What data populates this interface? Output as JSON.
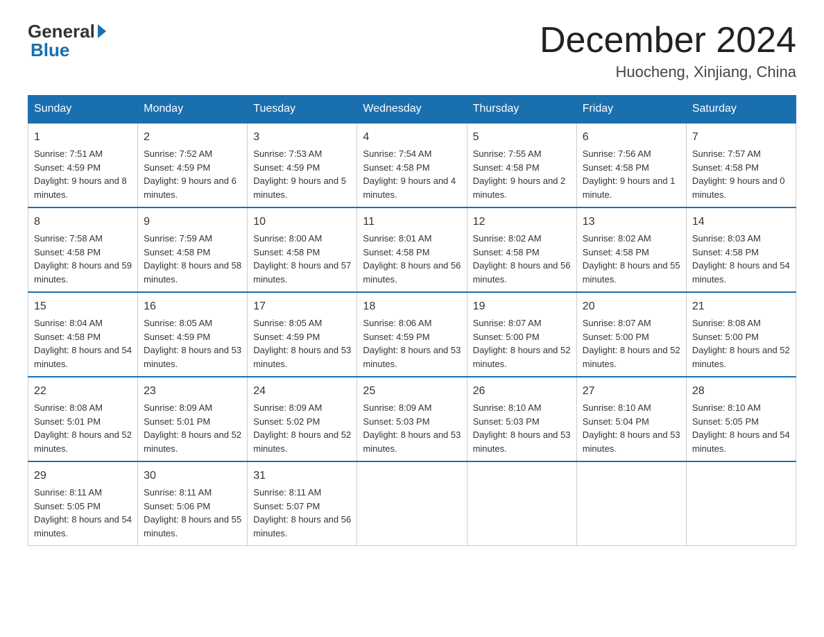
{
  "logo": {
    "general": "General",
    "blue": "Blue"
  },
  "title": "December 2024",
  "location": "Huocheng, Xinjiang, China",
  "headers": [
    "Sunday",
    "Monday",
    "Tuesday",
    "Wednesday",
    "Thursday",
    "Friday",
    "Saturday"
  ],
  "weeks": [
    [
      {
        "day": "1",
        "sunrise": "7:51 AM",
        "sunset": "4:59 PM",
        "daylight": "9 hours and 8 minutes."
      },
      {
        "day": "2",
        "sunrise": "7:52 AM",
        "sunset": "4:59 PM",
        "daylight": "9 hours and 6 minutes."
      },
      {
        "day": "3",
        "sunrise": "7:53 AM",
        "sunset": "4:59 PM",
        "daylight": "9 hours and 5 minutes."
      },
      {
        "day": "4",
        "sunrise": "7:54 AM",
        "sunset": "4:58 PM",
        "daylight": "9 hours and 4 minutes."
      },
      {
        "day": "5",
        "sunrise": "7:55 AM",
        "sunset": "4:58 PM",
        "daylight": "9 hours and 2 minutes."
      },
      {
        "day": "6",
        "sunrise": "7:56 AM",
        "sunset": "4:58 PM",
        "daylight": "9 hours and 1 minute."
      },
      {
        "day": "7",
        "sunrise": "7:57 AM",
        "sunset": "4:58 PM",
        "daylight": "9 hours and 0 minutes."
      }
    ],
    [
      {
        "day": "8",
        "sunrise": "7:58 AM",
        "sunset": "4:58 PM",
        "daylight": "8 hours and 59 minutes."
      },
      {
        "day": "9",
        "sunrise": "7:59 AM",
        "sunset": "4:58 PM",
        "daylight": "8 hours and 58 minutes."
      },
      {
        "day": "10",
        "sunrise": "8:00 AM",
        "sunset": "4:58 PM",
        "daylight": "8 hours and 57 minutes."
      },
      {
        "day": "11",
        "sunrise": "8:01 AM",
        "sunset": "4:58 PM",
        "daylight": "8 hours and 56 minutes."
      },
      {
        "day": "12",
        "sunrise": "8:02 AM",
        "sunset": "4:58 PM",
        "daylight": "8 hours and 56 minutes."
      },
      {
        "day": "13",
        "sunrise": "8:02 AM",
        "sunset": "4:58 PM",
        "daylight": "8 hours and 55 minutes."
      },
      {
        "day": "14",
        "sunrise": "8:03 AM",
        "sunset": "4:58 PM",
        "daylight": "8 hours and 54 minutes."
      }
    ],
    [
      {
        "day": "15",
        "sunrise": "8:04 AM",
        "sunset": "4:58 PM",
        "daylight": "8 hours and 54 minutes."
      },
      {
        "day": "16",
        "sunrise": "8:05 AM",
        "sunset": "4:59 PM",
        "daylight": "8 hours and 53 minutes."
      },
      {
        "day": "17",
        "sunrise": "8:05 AM",
        "sunset": "4:59 PM",
        "daylight": "8 hours and 53 minutes."
      },
      {
        "day": "18",
        "sunrise": "8:06 AM",
        "sunset": "4:59 PM",
        "daylight": "8 hours and 53 minutes."
      },
      {
        "day": "19",
        "sunrise": "8:07 AM",
        "sunset": "5:00 PM",
        "daylight": "8 hours and 52 minutes."
      },
      {
        "day": "20",
        "sunrise": "8:07 AM",
        "sunset": "5:00 PM",
        "daylight": "8 hours and 52 minutes."
      },
      {
        "day": "21",
        "sunrise": "8:08 AM",
        "sunset": "5:00 PM",
        "daylight": "8 hours and 52 minutes."
      }
    ],
    [
      {
        "day": "22",
        "sunrise": "8:08 AM",
        "sunset": "5:01 PM",
        "daylight": "8 hours and 52 minutes."
      },
      {
        "day": "23",
        "sunrise": "8:09 AM",
        "sunset": "5:01 PM",
        "daylight": "8 hours and 52 minutes."
      },
      {
        "day": "24",
        "sunrise": "8:09 AM",
        "sunset": "5:02 PM",
        "daylight": "8 hours and 52 minutes."
      },
      {
        "day": "25",
        "sunrise": "8:09 AM",
        "sunset": "5:03 PM",
        "daylight": "8 hours and 53 minutes."
      },
      {
        "day": "26",
        "sunrise": "8:10 AM",
        "sunset": "5:03 PM",
        "daylight": "8 hours and 53 minutes."
      },
      {
        "day": "27",
        "sunrise": "8:10 AM",
        "sunset": "5:04 PM",
        "daylight": "8 hours and 53 minutes."
      },
      {
        "day": "28",
        "sunrise": "8:10 AM",
        "sunset": "5:05 PM",
        "daylight": "8 hours and 54 minutes."
      }
    ],
    [
      {
        "day": "29",
        "sunrise": "8:11 AM",
        "sunset": "5:05 PM",
        "daylight": "8 hours and 54 minutes."
      },
      {
        "day": "30",
        "sunrise": "8:11 AM",
        "sunset": "5:06 PM",
        "daylight": "8 hours and 55 minutes."
      },
      {
        "day": "31",
        "sunrise": "8:11 AM",
        "sunset": "5:07 PM",
        "daylight": "8 hours and 56 minutes."
      },
      null,
      null,
      null,
      null
    ]
  ],
  "labels": {
    "sunrise": "Sunrise:",
    "sunset": "Sunset:",
    "daylight": "Daylight:"
  }
}
